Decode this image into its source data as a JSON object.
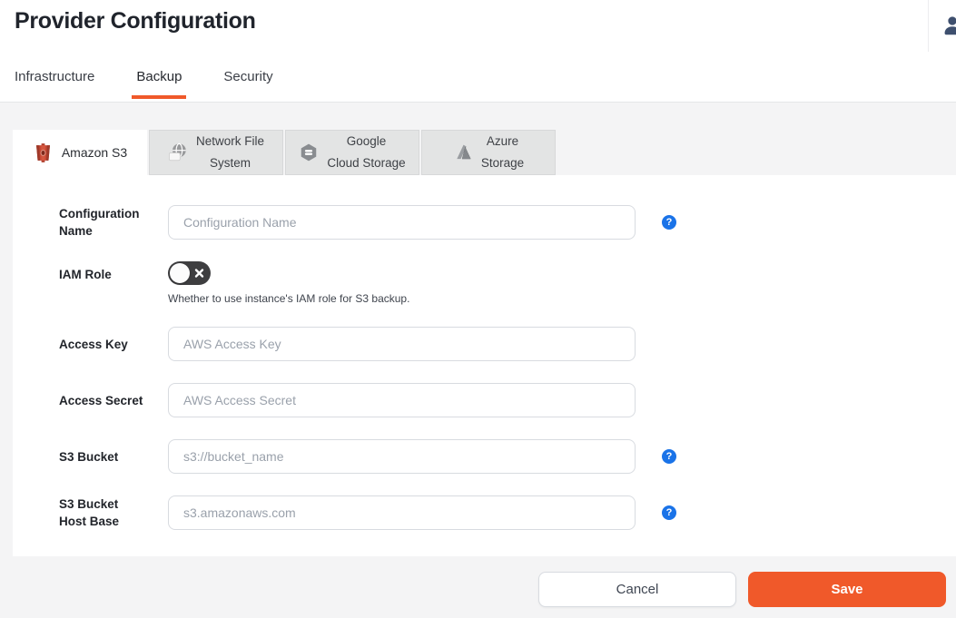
{
  "header": {
    "title": "Provider Configuration",
    "user_icon": "user-icon"
  },
  "main_tabs": [
    {
      "label": "Infrastructure",
      "active": false
    },
    {
      "label": "Backup",
      "active": true
    },
    {
      "label": "Security",
      "active": false
    }
  ],
  "provider_tabs": [
    {
      "label": "Amazon S3",
      "icon": "amazon-s3-icon",
      "active": true
    },
    {
      "label": "Network File\nSystem",
      "icon": "network-file-system-icon",
      "active": false
    },
    {
      "label": "Google\nCloud Storage",
      "icon": "google-cloud-storage-icon",
      "active": false
    },
    {
      "label": "Azure\nStorage",
      "icon": "azure-storage-icon",
      "active": false
    }
  ],
  "form": {
    "fields": [
      {
        "label": "Configuration Name",
        "type": "text",
        "value": "",
        "placeholder": "Configuration Name",
        "help": true
      },
      {
        "label": "IAM Role",
        "type": "toggle",
        "value": "off",
        "help_text": "Whether to use instance's IAM role for S3 backup."
      },
      {
        "label": "Access Key",
        "type": "text",
        "value": "",
        "placeholder": "AWS Access Key",
        "help": false
      },
      {
        "label": "Access Secret",
        "type": "text",
        "value": "",
        "placeholder": "AWS Access Secret",
        "help": false
      },
      {
        "label": "S3 Bucket",
        "type": "text",
        "value": "",
        "placeholder": "s3://bucket_name",
        "help": true
      },
      {
        "label": "S3 Bucket Host Base",
        "type": "text",
        "value": "",
        "placeholder": "s3.amazonaws.com",
        "help": true
      }
    ],
    "buttons": {
      "cancel": "Cancel",
      "save": "Save"
    }
  },
  "icons": {
    "help_glyph": "?"
  },
  "colors": {
    "accent_orange": "#F0592A",
    "help_blue": "#1A73E8",
    "toggle_off": "#3E3E40",
    "page_gray": "#F4F4F5",
    "tab_gray": "#E3E4E4"
  }
}
